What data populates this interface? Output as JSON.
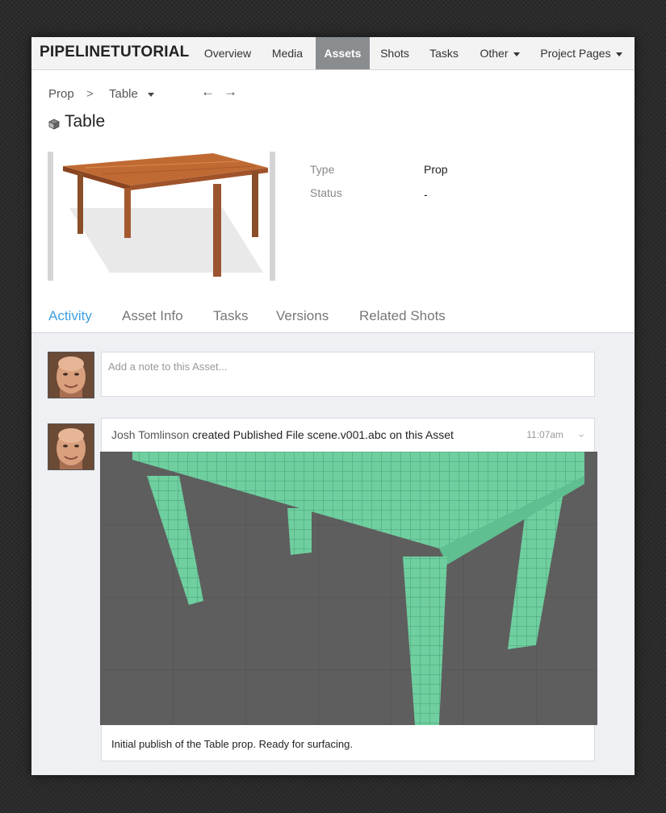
{
  "nav": {
    "brand": "PIPELINETUTORIAL",
    "items": [
      {
        "label": "Overview"
      },
      {
        "label": "Media"
      },
      {
        "label": "Assets"
      },
      {
        "label": "Shots"
      },
      {
        "label": "Tasks"
      },
      {
        "label": "Other"
      },
      {
        "label": "Project Pages"
      }
    ]
  },
  "breadcrumb": {
    "parent": "Prop",
    "separator": ">",
    "current": "Table",
    "prev_icon": "←",
    "next_icon": "→"
  },
  "asset": {
    "title": "Table",
    "icon": "cube-icon",
    "fields": [
      {
        "label": "Type",
        "value": "Prop"
      },
      {
        "label": "Status",
        "value": "-"
      }
    ]
  },
  "tabs": [
    {
      "label": "Activity"
    },
    {
      "label": "Asset Info"
    },
    {
      "label": "Tasks"
    },
    {
      "label": "Versions"
    },
    {
      "label": "Related Shots"
    }
  ],
  "note": {
    "placeholder": "Add a note to this Asset..."
  },
  "activity": {
    "user": "Josh Tomlinson",
    "action": "created Published File scene.v001.abc on this Asset",
    "time": "11:07am",
    "caption": "Initial publish of the Table prop. Ready for surfacing."
  },
  "colors": {
    "accent": "#3ea0e0",
    "active_nav": "#8a8d90",
    "wireframe": "#7fd4b0"
  }
}
